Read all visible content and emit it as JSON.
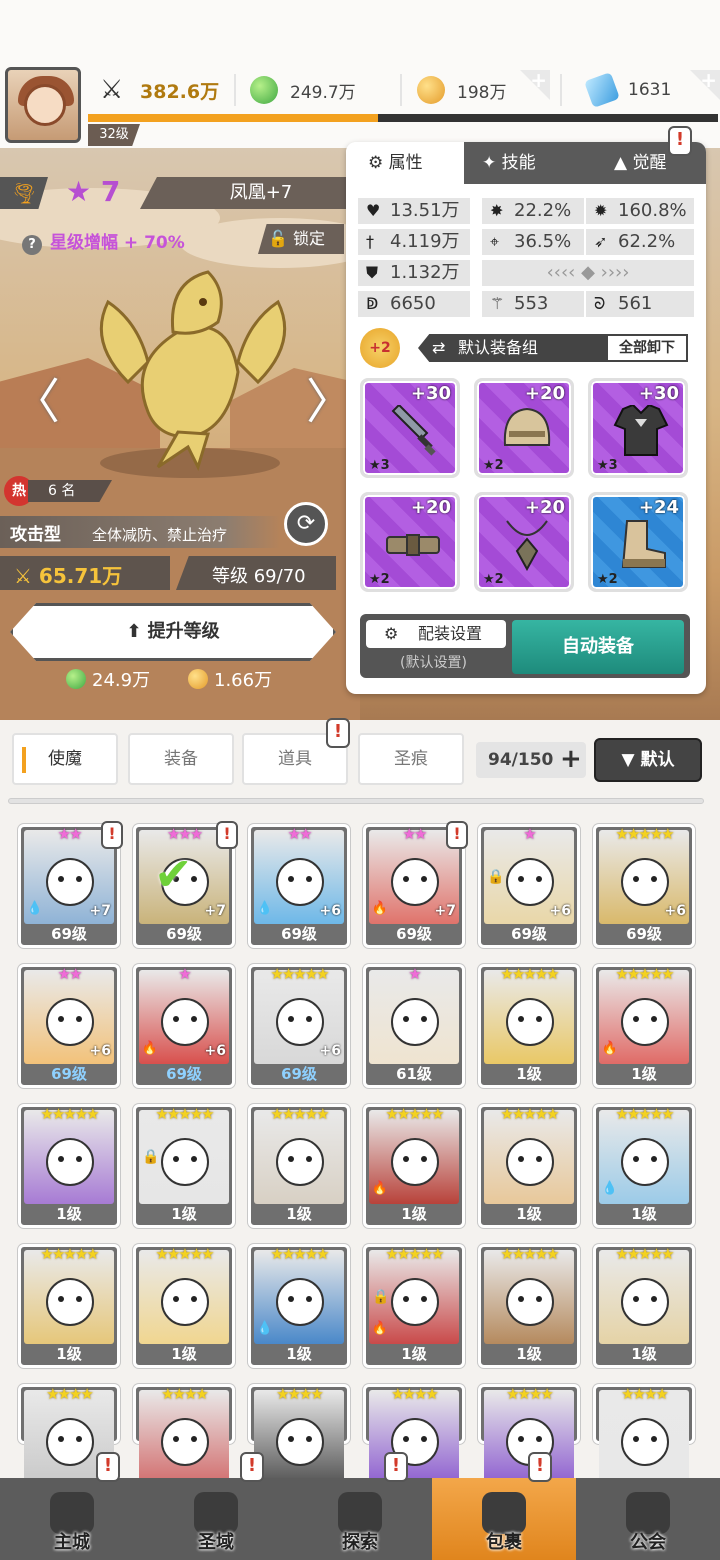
{
  "topbar": {
    "power": "382.6万",
    "green_gem": "249.7万",
    "coin": "198万",
    "diamond": "1631",
    "player_level": "32级",
    "xp_progress": 0.46
  },
  "hero": {
    "star_count": "7",
    "name": "凤凰+7",
    "star_boost": "星级增幅 + 70%",
    "lock_label": "锁定",
    "hot_label": "热",
    "hot_rank": "6 名",
    "type_label": "攻击型",
    "type_desc": "全体减防、禁止治疗",
    "power": "65.71万",
    "level": "等级 69/70",
    "upgrade_label": "提升等级",
    "upgrade_cost_green": "24.9万",
    "upgrade_cost_gold": "1.66万"
  },
  "panel": {
    "tabs": [
      "属性",
      "技能",
      "觉醒"
    ],
    "stats": {
      "hp": "13.51万",
      "crit": "22.2%",
      "crit_dmg": "160.8%",
      "atk": "4.119万",
      "accuracy": "36.5%",
      "speed": "62.2%",
      "def": "1.132万",
      "stat7": "6650",
      "stat8": "553",
      "stat9": "561"
    },
    "loadout_bonus": "+2",
    "loadout_name": "默认装备组",
    "unequip_all": "全部卸下",
    "equipment": [
      {
        "name": "sword",
        "level": "+30",
        "stars": "★3",
        "color": "purple"
      },
      {
        "name": "helmet",
        "level": "+20",
        "stars": "★2",
        "color": "purple"
      },
      {
        "name": "armor",
        "level": "+30",
        "stars": "★3",
        "color": "purple"
      },
      {
        "name": "belt",
        "level": "+20",
        "stars": "★2",
        "color": "purple"
      },
      {
        "name": "necklace",
        "level": "+20",
        "stars": "★2",
        "color": "purple"
      },
      {
        "name": "boots",
        "level": "+24",
        "stars": "★2",
        "color": "blue"
      }
    ],
    "config_label": "配装设置",
    "config_sub": "(默认设置)",
    "auto_equip": "自动装备"
  },
  "categories": [
    "使魔",
    "装备",
    "道具",
    "圣痕"
  ],
  "inventory_count": "94/150",
  "sort_label": "默认",
  "cards": [
    {
      "stars": "★★",
      "pink": true,
      "level": "69级",
      "plus": "+7",
      "alert": true,
      "color": "#8fb3d6",
      "el": "💧"
    },
    {
      "stars": "★★★",
      "pink": true,
      "level": "69级",
      "plus": "+7",
      "alert": true,
      "color": "#c9b37a",
      "check": true
    },
    {
      "stars": "★★",
      "pink": true,
      "level": "69级",
      "plus": "+6",
      "color": "#6eb8e8",
      "el": "💧"
    },
    {
      "stars": "★★",
      "pink": true,
      "level": "69级",
      "plus": "+7",
      "alert": true,
      "color": "#e0736b",
      "el": "🔥"
    },
    {
      "stars": "★",
      "pink": true,
      "level": "69级",
      "plus": "+6",
      "color": "#e9d7a8",
      "lock": true
    },
    {
      "stars": "★★★★★",
      "level": "69级",
      "plus": "+6",
      "color": "#d9b96b"
    },
    {
      "stars": "★★",
      "pink": true,
      "level": "69级",
      "plus": "+6",
      "color": "#f2c27a",
      "blue": true
    },
    {
      "stars": "★",
      "pink": true,
      "level": "69级",
      "plus": "+6",
      "color": "#d8504d",
      "blue": true,
      "el": "🔥"
    },
    {
      "stars": "★★★★★",
      "level": "69级",
      "plus": "+6",
      "color": "#d8d8d8",
      "blue": true
    },
    {
      "stars": "★",
      "pink": true,
      "level": "61级",
      "color": "#efe4d0"
    },
    {
      "stars": "★★★★★",
      "level": "1级",
      "color": "#e9c866"
    },
    {
      "stars": "★★★★★",
      "level": "1级",
      "color": "#e06b67",
      "el": "🔥"
    },
    {
      "stars": "★★★★★",
      "level": "1级",
      "color": "#a77bd4"
    },
    {
      "stars": "★★★★★",
      "level": "1级",
      "color": "#e6e6e6",
      "lock": true
    },
    {
      "stars": "★★★★★",
      "level": "1级",
      "color": "#d8d0c4"
    },
    {
      "stars": "★★★★★",
      "level": "1级",
      "color": "#b8423a",
      "el": "🔥"
    },
    {
      "stars": "★★★★★",
      "level": "1级",
      "color": "#e8c89a"
    },
    {
      "stars": "★★★★★",
      "level": "1级",
      "color": "#9ccbe8",
      "el": "💧"
    },
    {
      "stars": "★★★★★",
      "level": "1级",
      "color": "#e6c77a"
    },
    {
      "stars": "★★★★★",
      "level": "1级",
      "color": "#f0d690"
    },
    {
      "stars": "★★★★★",
      "level": "1级",
      "color": "#4a88c9",
      "el": "💧"
    },
    {
      "stars": "★★★★★",
      "level": "1级",
      "color": "#c94a4a",
      "lock": true,
      "el": "🔥"
    },
    {
      "stars": "★★★★★",
      "level": "1级",
      "color": "#b58a5e"
    },
    {
      "stars": "★★★★★",
      "level": "1级",
      "color": "#e5d3a6"
    },
    {
      "stars": "★★★★",
      "level": "",
      "color": "#c9c9c9"
    },
    {
      "stars": "★★★★",
      "level": "",
      "color": "#d26e6e"
    },
    {
      "stars": "★★★★",
      "level": "",
      "color": "#555"
    },
    {
      "stars": "★★★★",
      "level": "",
      "color": "#8e5fd0"
    },
    {
      "stars": "★★★★",
      "level": "",
      "color": "#8e5fd0"
    },
    {
      "stars": "★★★★",
      "level": "",
      "color": "#e8e8e8"
    }
  ],
  "nav": [
    {
      "label": "主城",
      "alert": true
    },
    {
      "label": "圣域",
      "alert": true
    },
    {
      "label": "探索",
      "alert": true
    },
    {
      "label": "包裹",
      "alert": true,
      "active": true
    },
    {
      "label": "公会",
      "alert": false
    }
  ]
}
